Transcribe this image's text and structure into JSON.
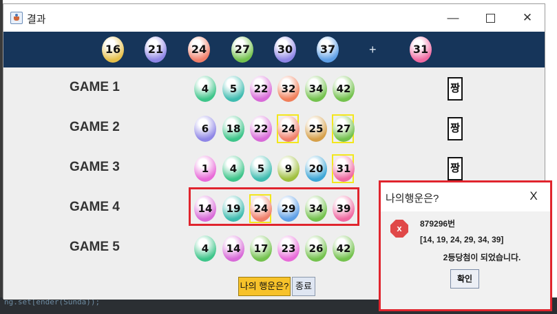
{
  "window": {
    "title": "결과",
    "controls": {
      "minimize": "—",
      "close": "✕"
    }
  },
  "background_code": "ng.set[ender(Sunda));",
  "winning": {
    "numbers": [
      {
        "value": "16",
        "color": "#e6c04a"
      },
      {
        "value": "21",
        "color": "#8f86e6"
      },
      {
        "value": "24",
        "color": "#f07f6a"
      },
      {
        "value": "27",
        "color": "#74c24e"
      },
      {
        "value": "30",
        "color": "#8f86e6"
      },
      {
        "value": "37",
        "color": "#5e9fe6"
      }
    ],
    "plus": "+",
    "bonus": {
      "value": "31",
      "color": "#f06aa2"
    }
  },
  "games": [
    {
      "label": "GAME 1",
      "auto": "짱",
      "balls": [
        {
          "value": "4",
          "color": "#3ec58a",
          "highlight": false
        },
        {
          "value": "5",
          "color": "#3fbcb0",
          "highlight": false
        },
        {
          "value": "22",
          "color": "#d86ad8",
          "highlight": false
        },
        {
          "value": "32",
          "color": "#f07f5a",
          "highlight": false
        },
        {
          "value": "34",
          "color": "#74c24e",
          "highlight": false
        },
        {
          "value": "42",
          "color": "#74c24e",
          "highlight": false
        }
      ]
    },
    {
      "label": "GAME 2",
      "auto": "짱",
      "balls": [
        {
          "value": "6",
          "color": "#8f86e6",
          "highlight": false
        },
        {
          "value": "18",
          "color": "#3ec58a",
          "highlight": false
        },
        {
          "value": "22",
          "color": "#d86ad8",
          "highlight": false
        },
        {
          "value": "24",
          "color": "#f07f6a",
          "highlight": true
        },
        {
          "value": "25",
          "color": "#d6a04a",
          "highlight": false
        },
        {
          "value": "27",
          "color": "#74c24e",
          "highlight": true
        }
      ]
    },
    {
      "label": "GAME 3",
      "auto": "짱",
      "balls": [
        {
          "value": "1",
          "color": "#e86ad8",
          "highlight": false
        },
        {
          "value": "4",
          "color": "#3ec58a",
          "highlight": false
        },
        {
          "value": "5",
          "color": "#3fbcb0",
          "highlight": false
        },
        {
          "value": "9",
          "color": "#9fbf3e",
          "highlight": false
        },
        {
          "value": "20",
          "color": "#3ea6d6",
          "highlight": false
        },
        {
          "value": "31",
          "color": "#f06aa2",
          "highlight": true
        }
      ]
    },
    {
      "label": "GAME 4",
      "auto": "",
      "balls": [
        {
          "value": "14",
          "color": "#d86ad8",
          "highlight": false
        },
        {
          "value": "19",
          "color": "#3fbcb0",
          "highlight": false
        },
        {
          "value": "24",
          "color": "#f07f6a",
          "highlight": true
        },
        {
          "value": "29",
          "color": "#5e9fe6",
          "highlight": false
        },
        {
          "value": "34",
          "color": "#74c24e",
          "highlight": false
        },
        {
          "value": "39",
          "color": "#f06aa2",
          "highlight": false
        }
      ]
    },
    {
      "label": "GAME 5",
      "auto": "",
      "balls": [
        {
          "value": "4",
          "color": "#3ec58a",
          "highlight": false
        },
        {
          "value": "14",
          "color": "#d86ad8",
          "highlight": false
        },
        {
          "value": "17",
          "color": "#74c24e",
          "highlight": false
        },
        {
          "value": "23",
          "color": "#e86ad8",
          "highlight": false
        },
        {
          "value": "26",
          "color": "#74c24e",
          "highlight": false
        },
        {
          "value": "42",
          "color": "#74c24e",
          "highlight": false
        }
      ]
    }
  ],
  "buttons": {
    "luck": "나의 행운은?",
    "exit": "종료"
  },
  "dialog": {
    "title": "나의행운은?",
    "close": "X",
    "icon": "x",
    "line1": "879296번",
    "line2": "[14, 19, 24, 29, 34, 39]",
    "line3": "2등당첨이 되었습니다.",
    "ok": "확인"
  }
}
